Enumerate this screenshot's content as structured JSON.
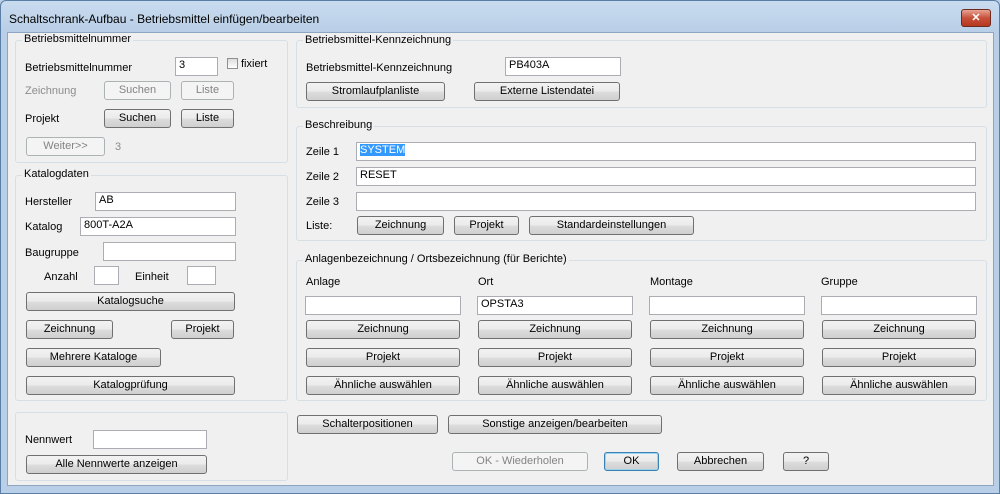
{
  "window": {
    "title": "Schaltschrank-Aufbau - Betriebsmittel einfügen/bearbeiten",
    "close": "✕"
  },
  "bmnr": {
    "group": "Betriebsmittelnummer",
    "label": "Betriebsmittelnummer",
    "value": "3",
    "fixiert": "fixiert",
    "zeichnung": "Zeichnung",
    "projekt": "Projekt",
    "suchen": "Suchen",
    "liste": "Liste",
    "weiter": "Weiter>>",
    "weiter_count": "3"
  },
  "katalog": {
    "group": "Katalogdaten",
    "hersteller_label": "Hersteller",
    "hersteller": "AB",
    "katalog_label": "Katalog",
    "katalog": "800T-A2A",
    "baugruppe_label": "Baugruppe",
    "baugruppe": "",
    "anzahl_label": "Anzahl",
    "anzahl": "",
    "einheit_label": "Einheit",
    "einheit": "",
    "katalogsuche": "Katalogsuche",
    "zeichnung": "Zeichnung",
    "projekt": "Projekt",
    "mehrere": "Mehrere Kataloge",
    "pruefung": "Katalogprüfung"
  },
  "nennwert": {
    "label": "Nennwert",
    "value": "",
    "alle": "Alle Nennwerte anzeigen"
  },
  "kenn": {
    "group": "Betriebsmittel-Kennzeichnung",
    "label": "Betriebsmittel-Kennzeichnung",
    "value": "PB403A",
    "stromlauf": "Stromlaufplanliste",
    "extern": "Externe Listendatei"
  },
  "beschreibung": {
    "group": "Beschreibung",
    "zeile1_label": "Zeile 1",
    "zeile1": "SYSTEM",
    "zeile2_label": "Zeile 2",
    "zeile2": "RESET",
    "zeile3_label": "Zeile 3",
    "zeile3": "",
    "liste_label": "Liste:",
    "zeichnung": "Zeichnung",
    "projekt": "Projekt",
    "standard": "Standardeinstellungen"
  },
  "anlagen": {
    "group": "Anlagenbezeichnung / Ortsbezeichnung (für Berichte)",
    "columns": [
      {
        "label": "Anlage",
        "value": ""
      },
      {
        "label": "Ort",
        "value": "OPSTA3"
      },
      {
        "label": "Montage",
        "value": ""
      },
      {
        "label": "Gruppe",
        "value": ""
      }
    ],
    "zeichnung": "Zeichnung",
    "projekt": "Projekt",
    "aehnliche": "Ähnliche auswählen"
  },
  "footer": {
    "schalterpositionen": "Schalterpositionen",
    "sonstige": "Sonstige anzeigen/bearbeiten",
    "ok_wiederholen": "OK - Wiederholen",
    "ok": "OK",
    "abbrechen": "Abbrechen",
    "help": "?"
  }
}
